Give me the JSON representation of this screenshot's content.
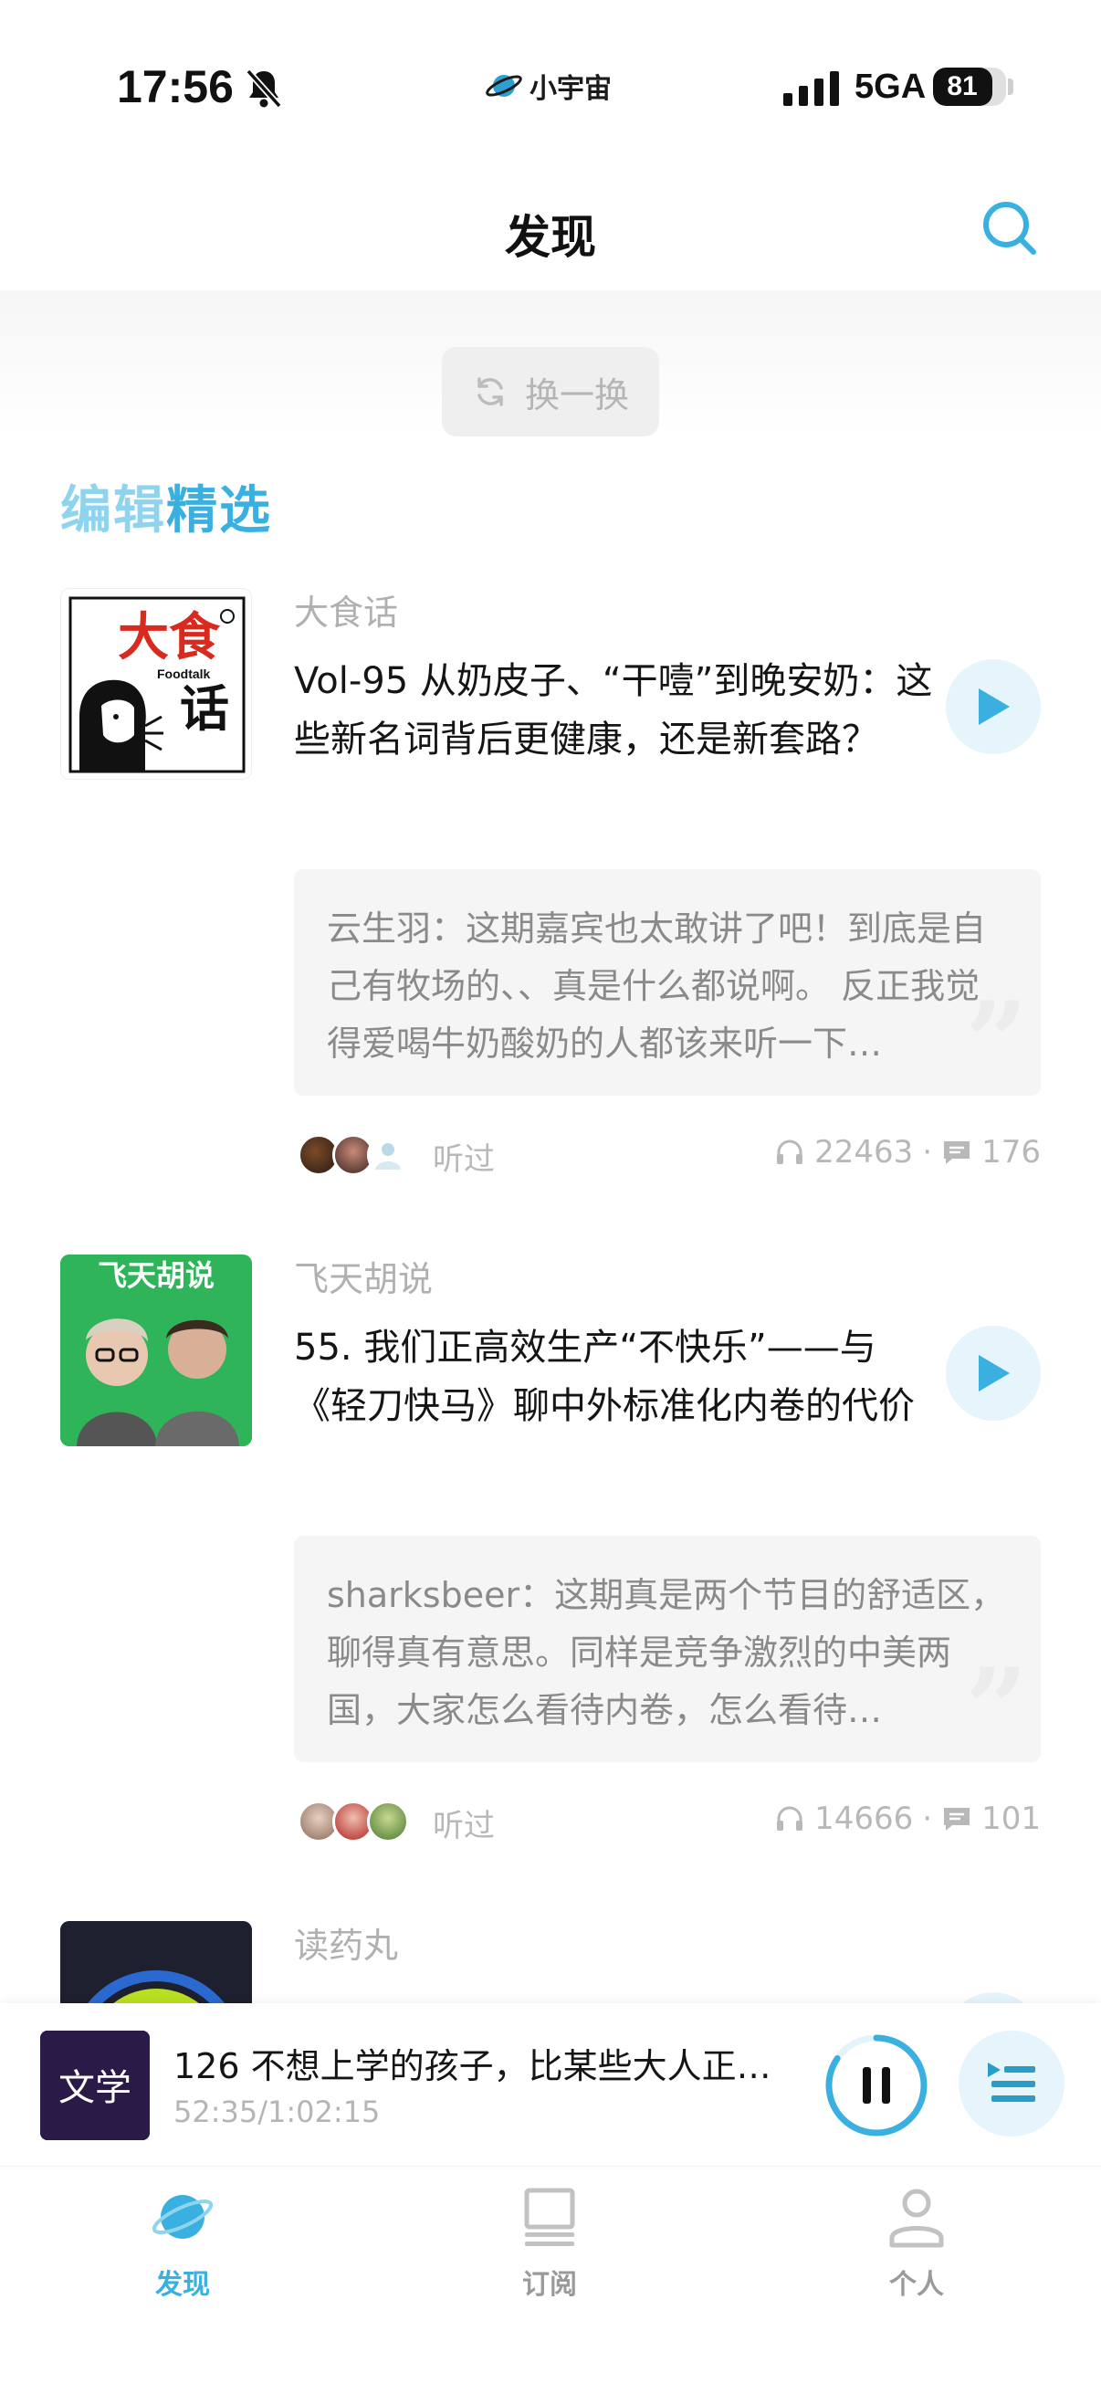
{
  "status_bar": {
    "time": "17:56",
    "brand": "小宇宙",
    "network": "5GA",
    "battery": "81",
    "battery_level": 0.81,
    "icons": [
      "bell-off-icon",
      "planet-icon",
      "signal-icon",
      "battery-icon"
    ]
  },
  "header": {
    "title": "发现",
    "search_icon": "search-icon"
  },
  "refresh": {
    "label": "换一换",
    "icon": "refresh-icon"
  },
  "section": {
    "title_part1": "编辑",
    "title_part2": "精选"
  },
  "episodes": [
    {
      "podcast": "大食话",
      "title": "Vol-95 从奶皮子、“干噎”到晚安奶：这些新名词背后更健康，还是新套路？",
      "comment_author": "云生羽",
      "comment_sep": "：",
      "comment_text": "这期嘉宾也太敢讲了吧！到底是自己有牧场的、、真是什么都说啊。 反正我觉得爱喝牛奶酸奶的人都该来听一下…",
      "listened_label": "听过",
      "plays": "22463",
      "dot": "·",
      "comments": "176",
      "cover_text_main": "大食",
      "cover_text_sub": "Foodtalk",
      "cover_text_hua": "话"
    },
    {
      "podcast": "飞天胡说",
      "title": "55. 我们正高效生产“不快乐”——与《轻刀快马》聊中外标准化内卷的代价",
      "comment_author": "sharksbeer",
      "comment_sep": "：",
      "comment_text": "这期真是两个节目的舒适区，聊得真有意思。同样是竞争激烈的中美两国，大家怎么看待内卷，怎么看待…",
      "listened_label": "听过",
      "plays": "14666",
      "dot": "·",
      "comments": "101",
      "cover_text_main": "飞天胡说"
    },
    {
      "podcast": "读药丸"
    }
  ],
  "mini_player": {
    "title": "126 不想上学的孩子，比某些大人正…",
    "time": "52:35/1:02:15",
    "progress": 0.845,
    "cover_text": "文学"
  },
  "tabs": [
    {
      "label": "发现",
      "icon": "planet-icon",
      "active": true
    },
    {
      "label": "订阅",
      "icon": "subscription-icon",
      "active": false
    },
    {
      "label": "个人",
      "icon": "person-icon",
      "active": false
    }
  ],
  "colors": {
    "accent": "#39b0e0",
    "accent_light": "#8fd4ee",
    "play_bg": "#e6f5fb",
    "muted": "#b0b0b0"
  }
}
